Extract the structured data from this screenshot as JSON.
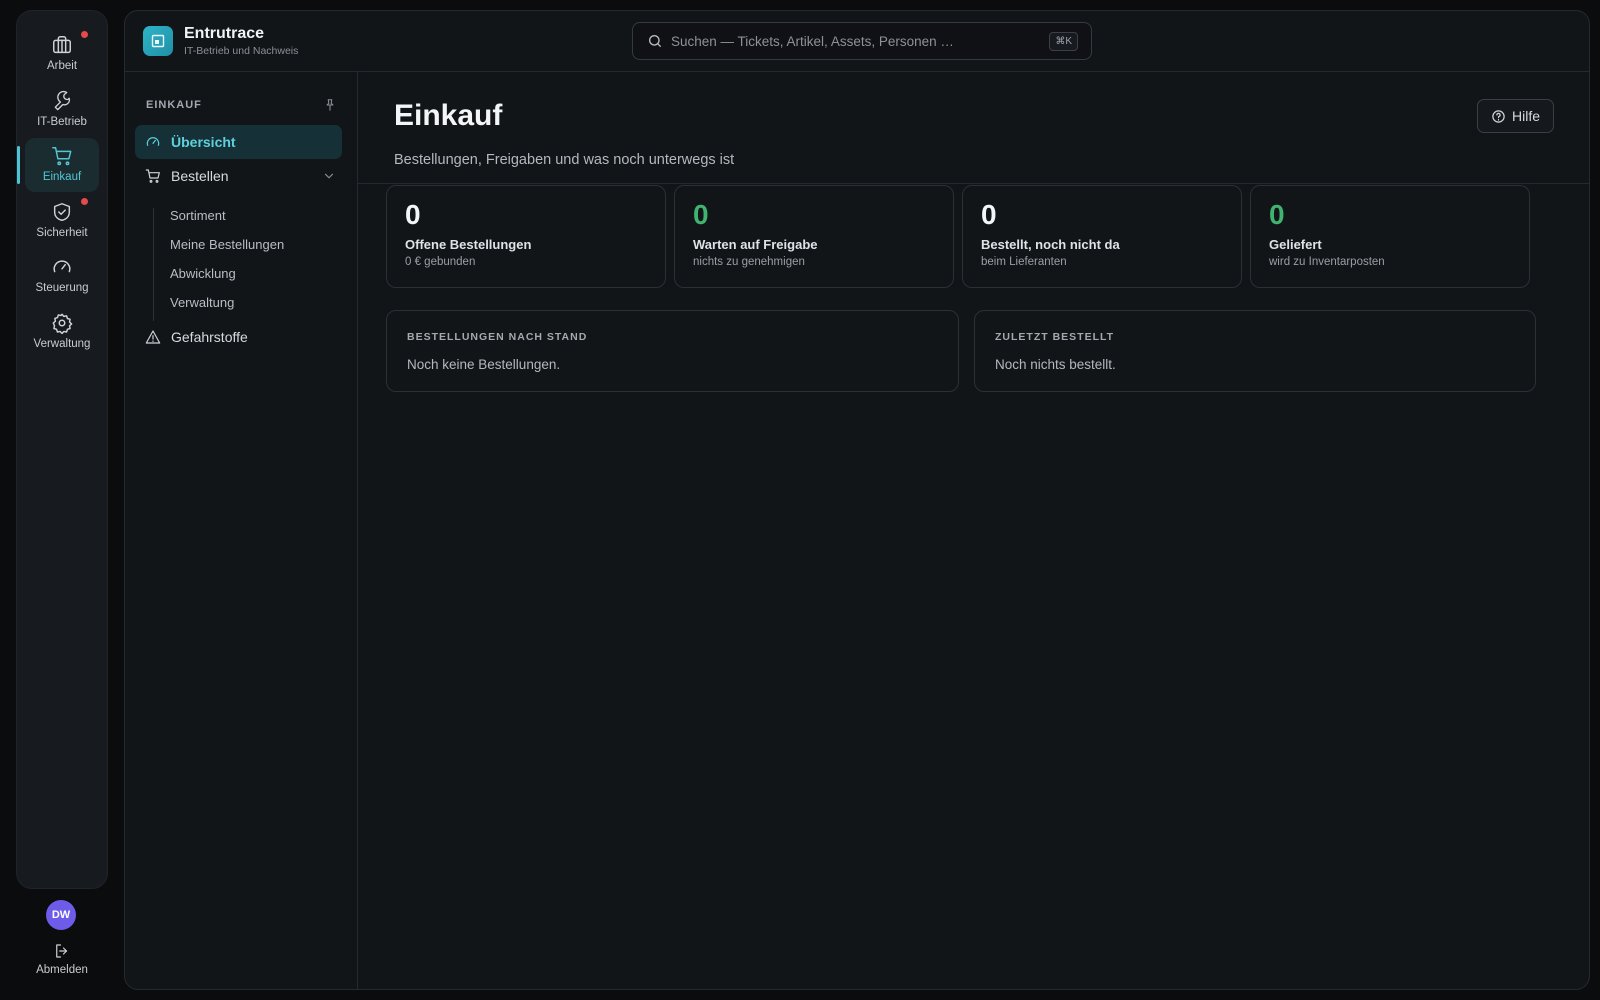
{
  "rail": {
    "items": [
      {
        "label": "Arbeit",
        "icon": "briefcase-icon",
        "badge": true
      },
      {
        "label": "IT-Betrieb",
        "icon": "wrench-icon",
        "badge": false
      },
      {
        "label": "Einkauf",
        "icon": "cart-icon",
        "badge": false,
        "active": true
      },
      {
        "label": "Sicherheit",
        "icon": "shield-check-icon",
        "badge": true
      },
      {
        "label": "Steuerung",
        "icon": "gauge-icon",
        "badge": false
      },
      {
        "label": "Verwaltung",
        "icon": "gear-icon",
        "badge": false
      }
    ],
    "avatar_initials": "DW",
    "logout_label": "Abmelden"
  },
  "brand": {
    "name": "Entrutrace",
    "subtitle": "IT-Betrieb und Nachweis"
  },
  "search": {
    "placeholder": "Suchen — Tickets, Artikel, Assets, Personen …",
    "shortcut": "⌘K"
  },
  "subnav": {
    "title": "EINKAUF",
    "items": [
      {
        "label": "Übersicht",
        "icon": "gauge-icon",
        "active": true
      },
      {
        "label": "Bestellen",
        "icon": "cart-icon",
        "expanded": true
      },
      {
        "label": "Gefahrstoffe",
        "icon": "warning-icon"
      }
    ],
    "sub_items": [
      "Sortiment",
      "Meine Bestellungen",
      "Abwicklung",
      "Verwaltung"
    ]
  },
  "page": {
    "title": "Einkauf",
    "subtitle": "Bestellungen, Freigaben und was noch unterwegs ist",
    "help_label": "Hilfe"
  },
  "stats": [
    {
      "value": "0",
      "label": "Offene Bestellungen",
      "sub": "0 € gebunden",
      "green": false
    },
    {
      "value": "0",
      "label": "Warten auf Freigabe",
      "sub": "nichts zu genehmigen",
      "green": true
    },
    {
      "value": "0",
      "label": "Bestellt, noch nicht da",
      "sub": "beim Lieferanten",
      "green": false
    },
    {
      "value": "0",
      "label": "Geliefert",
      "sub": "wird zu Inventarposten",
      "green": true
    }
  ],
  "panels": [
    {
      "title": "BESTELLUNGEN NACH STAND",
      "empty": "Noch keine Bestellungen."
    },
    {
      "title": "ZULETZT BESTELLT",
      "empty": "Noch nichts bestellt."
    }
  ],
  "colors": {
    "accent": "#4cc4d3",
    "success": "#3fb36f",
    "badge": "#e54a4a",
    "avatar": "#6c5ce7"
  }
}
